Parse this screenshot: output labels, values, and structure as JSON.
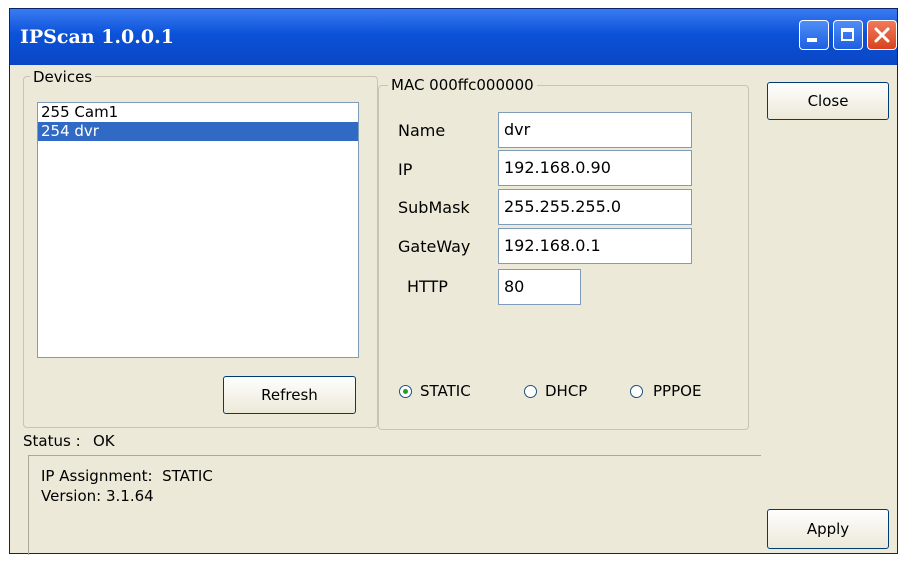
{
  "window": {
    "title": "IPScan 1.0.0.1"
  },
  "devices": {
    "group_label": "Devices",
    "items": [
      "255 Cam1",
      "254 dvr"
    ],
    "selected_index": 1,
    "refresh_label": "Refresh"
  },
  "details": {
    "group_label": "MAC 000ffc000000",
    "name_label": "Name",
    "name_value": "dvr",
    "ip_label": "IP",
    "ip_value": "192.168.0.90",
    "submask_label": "SubMask",
    "submask_value": "255.255.255.0",
    "gateway_label": "GateWay",
    "gateway_value": "192.168.0.1",
    "http_label": "HTTP",
    "http_value": "80",
    "modes": [
      {
        "label": "STATIC",
        "selected": true
      },
      {
        "label": "DHCP",
        "selected": false
      },
      {
        "label": "PPPOE",
        "selected": false
      }
    ]
  },
  "buttons": {
    "close": "Close",
    "apply": "Apply"
  },
  "status": {
    "label": "Status :",
    "value": "OK",
    "lines": [
      "IP Assignment:  STATIC",
      "Version: 3.1.64"
    ]
  }
}
